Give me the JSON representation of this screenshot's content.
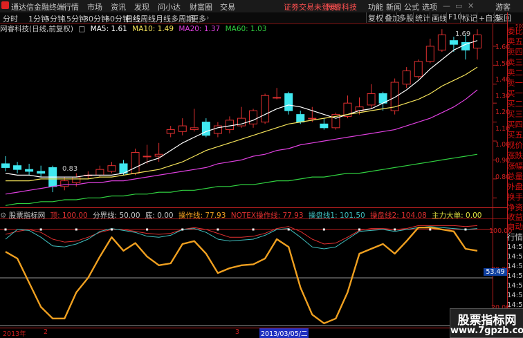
{
  "app": {
    "title": "通达信金融终端",
    "menu": [
      "行情",
      "市场",
      "资讯",
      "发现",
      "问小达",
      "财富圈",
      "交易"
    ],
    "notice": "证劵交易未登录",
    "stock_notice": "网睿科技",
    "right_menu": [
      "功能",
      "新闻",
      "公式",
      "选项"
    ],
    "user": "游客"
  },
  "toolbar": {
    "periods": [
      "分时",
      "1分钟",
      "5分钟",
      "15分钟",
      "30分钟",
      "60分钟",
      "日线",
      "周线",
      "月线",
      "多周期",
      "更多"
    ],
    "active": "日线",
    "right": [
      "复权",
      "叠加",
      "多股",
      "统计",
      "画线",
      "F10",
      "标记",
      "+自选",
      "返回"
    ]
  },
  "main_chart": {
    "stock_label": "网睿科技(日线,前复权)",
    "ma": [
      {
        "label": "MA5: 1.61",
        "color": "#ffffff"
      },
      {
        "label": "MA10: 1.49",
        "color": "#f5e35a"
      },
      {
        "label": "MA20: 1.37",
        "color": "#e040e0"
      },
      {
        "label": "MA60: 1.03",
        "color": "#30d040"
      }
    ],
    "y_ticks": [
      "1.60",
      "1.50",
      "1.40",
      "1.30",
      "1.20",
      "1.10",
      "1.00",
      "0.90",
      "0.80"
    ],
    "annotations": {
      "high": "1.69",
      "low": "0.83"
    }
  },
  "indicator": {
    "title": "股票指标网",
    "items": [
      {
        "label": "顶: 100.00",
        "color": "#e03030"
      },
      {
        "label": "分界线: 50.00",
        "color": "#c8c8c8"
      },
      {
        "label": "底: 0.00",
        "color": "#c8c8c8"
      },
      {
        "label": "操作线: 77.93",
        "color": "#f0a020"
      },
      {
        "label": "NOTEX操作线: 77.93",
        "color": "#e03030"
      },
      {
        "label": "操盘线1: 101.50",
        "color": "#40c0c0"
      },
      {
        "label": "操盘线2: 104.08",
        "color": "#e03030"
      },
      {
        "label": "主力大单: 0.00",
        "color": "#e0e040"
      }
    ],
    "y_ticks": [
      "100.00",
      "80.00",
      "20.00"
    ],
    "current_value": "53.49"
  },
  "dates": {
    "year": "2013年",
    "m1": "2",
    "m2": "3",
    "cursor": "2013/03/05/二"
  },
  "right_panel": {
    "labels": [
      "委比",
      "卖五",
      "卖四",
      "卖三",
      "卖二",
      "卖一",
      "买一",
      "买二",
      "买三",
      "买四",
      "买五",
      "现价",
      "涨跌",
      "涨幅",
      "总量",
      "外盘",
      "换手",
      "净资",
      "收益"
    ],
    "tabs": [
      "自动",
      "行情"
    ],
    "times": [
      "14:56",
      "14:56",
      "14:56",
      "14:56",
      "14:56",
      "14:56",
      "14:56",
      "14:56",
      "14:56",
      "14:56"
    ],
    "top_value": "500"
  },
  "watermark": {
    "title": "股票指标网",
    "url": "www.7gpzb.com"
  },
  "colors": {
    "up": "#e03030",
    "down": "#40e8f0",
    "ma5": "#ffffff",
    "ma10": "#f5e35a",
    "ma20": "#e040e0",
    "ma60": "#30d040",
    "op_line": "#f0a020"
  },
  "chart_data": [
    {
      "type": "candlestick",
      "title": "网睿科技(日线,前复权)",
      "ylim": [
        0.75,
        1.72
      ],
      "candles": [
        {
          "o": 0.98,
          "h": 1.02,
          "l": 0.94,
          "c": 0.96
        },
        {
          "o": 0.97,
          "h": 0.99,
          "l": 0.93,
          "c": 0.95
        },
        {
          "o": 0.95,
          "h": 0.98,
          "l": 0.92,
          "c": 0.94
        },
        {
          "o": 0.94,
          "h": 0.97,
          "l": 0.91,
          "c": 0.93
        },
        {
          "o": 0.96,
          "h": 0.97,
          "l": 0.83,
          "c": 0.86
        },
        {
          "o": 0.86,
          "h": 0.91,
          "l": 0.84,
          "c": 0.89
        },
        {
          "o": 0.88,
          "h": 0.93,
          "l": 0.86,
          "c": 0.91
        },
        {
          "o": 0.92,
          "h": 0.94,
          "l": 0.9,
          "c": 0.92
        },
        {
          "o": 0.92,
          "h": 0.97,
          "l": 0.91,
          "c": 0.95
        },
        {
          "o": 0.94,
          "h": 0.99,
          "l": 0.93,
          "c": 0.97
        },
        {
          "o": 0.98,
          "h": 1.0,
          "l": 0.92,
          "c": 0.93
        },
        {
          "o": 0.93,
          "h": 1.06,
          "l": 0.92,
          "c": 1.04
        },
        {
          "o": 1.02,
          "h": 1.08,
          "l": 0.98,
          "c": 1.02
        },
        {
          "o": 1.02,
          "h": 1.09,
          "l": 0.99,
          "c": 1.03
        },
        {
          "o": 1.14,
          "h": 1.18,
          "l": 1.12,
          "c": 1.16
        },
        {
          "o": 1.15,
          "h": 1.22,
          "l": 1.13,
          "c": 1.18
        },
        {
          "o": 1.16,
          "h": 1.27,
          "l": 1.15,
          "c": 1.17
        },
        {
          "o": 1.2,
          "h": 1.22,
          "l": 1.12,
          "c": 1.13
        },
        {
          "o": 1.14,
          "h": 1.2,
          "l": 1.12,
          "c": 1.18
        },
        {
          "o": 1.16,
          "h": 1.23,
          "l": 1.14,
          "c": 1.21
        },
        {
          "o": 1.18,
          "h": 1.28,
          "l": 1.17,
          "c": 1.22
        },
        {
          "o": 1.19,
          "h": 1.27,
          "l": 1.17,
          "c": 1.26
        },
        {
          "o": 1.2,
          "h": 1.35,
          "l": 1.19,
          "c": 1.34
        },
        {
          "o": 1.33,
          "h": 1.38,
          "l": 1.32,
          "c": 1.33
        },
        {
          "o": 1.35,
          "h": 1.36,
          "l": 1.24,
          "c": 1.26
        },
        {
          "o": 1.24,
          "h": 1.26,
          "l": 1.19,
          "c": 1.2
        },
        {
          "o": 1.22,
          "h": 1.28,
          "l": 1.2,
          "c": 1.22
        },
        {
          "o": 1.19,
          "h": 1.22,
          "l": 1.16,
          "c": 1.17
        },
        {
          "o": 1.17,
          "h": 1.25,
          "l": 1.16,
          "c": 1.24
        },
        {
          "o": 1.23,
          "h": 1.34,
          "l": 1.22,
          "c": 1.3
        },
        {
          "o": 1.26,
          "h": 1.33,
          "l": 1.24,
          "c": 1.28
        },
        {
          "o": 1.29,
          "h": 1.4,
          "l": 1.27,
          "c": 1.35
        },
        {
          "o": 1.35,
          "h": 1.36,
          "l": 1.26,
          "c": 1.3
        },
        {
          "o": 1.26,
          "h": 1.43,
          "l": 1.24,
          "c": 1.41
        },
        {
          "o": 1.4,
          "h": 1.49,
          "l": 1.38,
          "c": 1.47
        },
        {
          "o": 1.44,
          "h": 1.53,
          "l": 1.43,
          "c": 1.52
        },
        {
          "o": 1.52,
          "h": 1.64,
          "l": 1.51,
          "c": 1.6
        },
        {
          "o": 1.58,
          "h": 1.69,
          "l": 1.57,
          "c": 1.66
        },
        {
          "o": 1.63,
          "h": 1.65,
          "l": 1.57,
          "c": 1.61
        },
        {
          "o": 1.62,
          "h": 1.66,
          "l": 1.53,
          "c": 1.58
        },
        {
          "o": 1.59,
          "h": 1.69,
          "l": 1.53,
          "c": 1.66
        }
      ],
      "ma": {
        "MA5": [
          0.93,
          0.92,
          0.92,
          0.91,
          0.91,
          0.91,
          0.91,
          0.92,
          0.92,
          0.92,
          0.93,
          0.96,
          0.99,
          1.01,
          1.05,
          1.09,
          1.12,
          1.15,
          1.17,
          1.18,
          1.19,
          1.21,
          1.24,
          1.27,
          1.29,
          1.28,
          1.26,
          1.24,
          1.22,
          1.24,
          1.26,
          1.27,
          1.3,
          1.33,
          1.37,
          1.42,
          1.48,
          1.53,
          1.58,
          1.61,
          1.63
        ],
        "MA10": [
          0.89,
          0.89,
          0.89,
          0.9,
          0.9,
          0.9,
          0.9,
          0.9,
          0.91,
          0.91,
          0.92,
          0.93,
          0.94,
          0.95,
          0.97,
          0.99,
          1.02,
          1.05,
          1.07,
          1.09,
          1.11,
          1.13,
          1.15,
          1.17,
          1.19,
          1.2,
          1.21,
          1.22,
          1.23,
          1.24,
          1.25,
          1.26,
          1.27,
          1.28,
          1.3,
          1.32,
          1.35,
          1.39,
          1.42,
          1.45,
          1.49
        ],
        "MA20": [
          0.82,
          0.83,
          0.84,
          0.85,
          0.86,
          0.87,
          0.87,
          0.88,
          0.88,
          0.89,
          0.89,
          0.9,
          0.91,
          0.92,
          0.93,
          0.94,
          0.95,
          0.96,
          0.98,
          0.99,
          1.0,
          1.02,
          1.03,
          1.05,
          1.06,
          1.08,
          1.09,
          1.1,
          1.11,
          1.12,
          1.13,
          1.14,
          1.15,
          1.16,
          1.18,
          1.2,
          1.22,
          1.25,
          1.28,
          1.32,
          1.37
        ],
        "MA60": [
          0.76,
          0.77,
          0.77,
          0.78,
          0.78,
          0.79,
          0.79,
          0.8,
          0.8,
          0.81,
          0.81,
          0.82,
          0.82,
          0.83,
          0.83,
          0.84,
          0.84,
          0.85,
          0.86,
          0.86,
          0.87,
          0.87,
          0.88,
          0.89,
          0.89,
          0.9,
          0.91,
          0.91,
          0.92,
          0.93,
          0.93,
          0.94,
          0.95,
          0.96,
          0.97,
          0.98,
          0.99,
          1.0,
          1.01,
          1.02,
          1.03
        ]
      }
    },
    {
      "type": "line",
      "title": "股票指标网",
      "ylim": [
        0,
        110
      ],
      "series": [
        {
          "name": "操作线",
          "values": [
            77,
            70,
            45,
            20,
            8,
            8,
            35,
            50,
            72,
            92,
            78,
            86,
            72,
            63,
            65,
            85,
            88,
            75,
            55,
            60,
            63,
            64,
            70,
            90,
            82,
            40,
            12,
            3,
            8,
            35,
            75,
            80,
            85,
            75,
            88,
            102,
            102,
            100,
            98,
            80,
            78
          ]
        },
        {
          "name": "操盘线1",
          "values": [
            90,
            100,
            99,
            92,
            83,
            82,
            85,
            90,
            98,
            101,
            99,
            97,
            93,
            92,
            94,
            100,
            101,
            97,
            90,
            88,
            89,
            90,
            94,
            100,
            101,
            92,
            82,
            80,
            82,
            90,
            98,
            99,
            100,
            98,
            100,
            102,
            103,
            102,
            101,
            100,
            101
          ]
        },
        {
          "name": "操盘线2",
          "values": [
            95,
            98,
            100,
            97,
            90,
            87,
            88,
            92,
            97,
            100,
            100,
            98,
            96,
            95,
            96,
            100,
            102,
            100,
            96,
            92,
            92,
            93,
            96,
            101,
            103,
            98,
            90,
            85,
            86,
            92,
            99,
            101,
            101,
            100,
            101,
            104,
            104,
            104,
            104,
            103,
            104
          ]
        }
      ]
    }
  ]
}
